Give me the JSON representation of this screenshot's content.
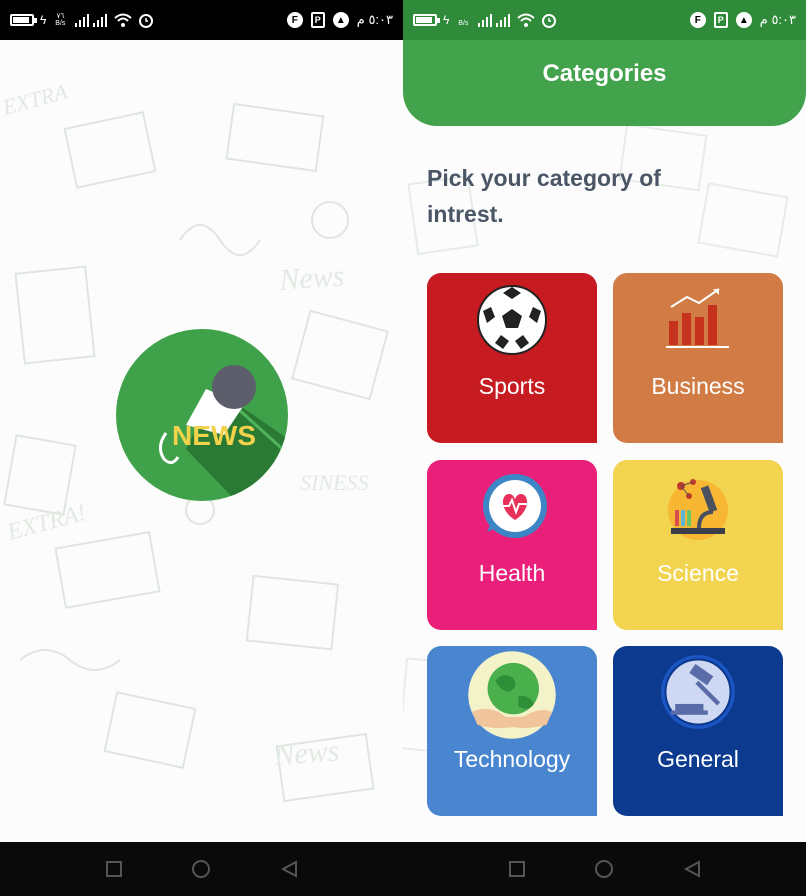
{
  "status_bar": {
    "time": "٥:٠٣ م",
    "speed_top": "٧٦",
    "speed_unit": "B/s",
    "app_icon_1": "F",
    "app_icon_2": "P"
  },
  "splash": {
    "logo_text": "NEWS"
  },
  "categories_screen": {
    "title": "Categories",
    "prompt": "Pick your category of intrest.",
    "categories": [
      {
        "label": "Sports",
        "color": "#c61b20",
        "icon": "soccer-ball-icon"
      },
      {
        "label": "Business",
        "color": "#d27c45",
        "icon": "bar-chart-icon"
      },
      {
        "label": "Health",
        "color": "#e91f7a",
        "icon": "heart-pulse-icon"
      },
      {
        "label": "Science",
        "color": "#f2d450",
        "icon": "microscope-icon"
      },
      {
        "label": "Technology",
        "color": "#4a86d0",
        "icon": "earth-hands-icon"
      },
      {
        "label": "General",
        "color": "#0b3a8f",
        "icon": "gavel-icon"
      }
    ]
  },
  "colors": {
    "header_green": "#43a24c",
    "status_green": "#2f8a3a",
    "prompt_text": "#4a5566"
  }
}
